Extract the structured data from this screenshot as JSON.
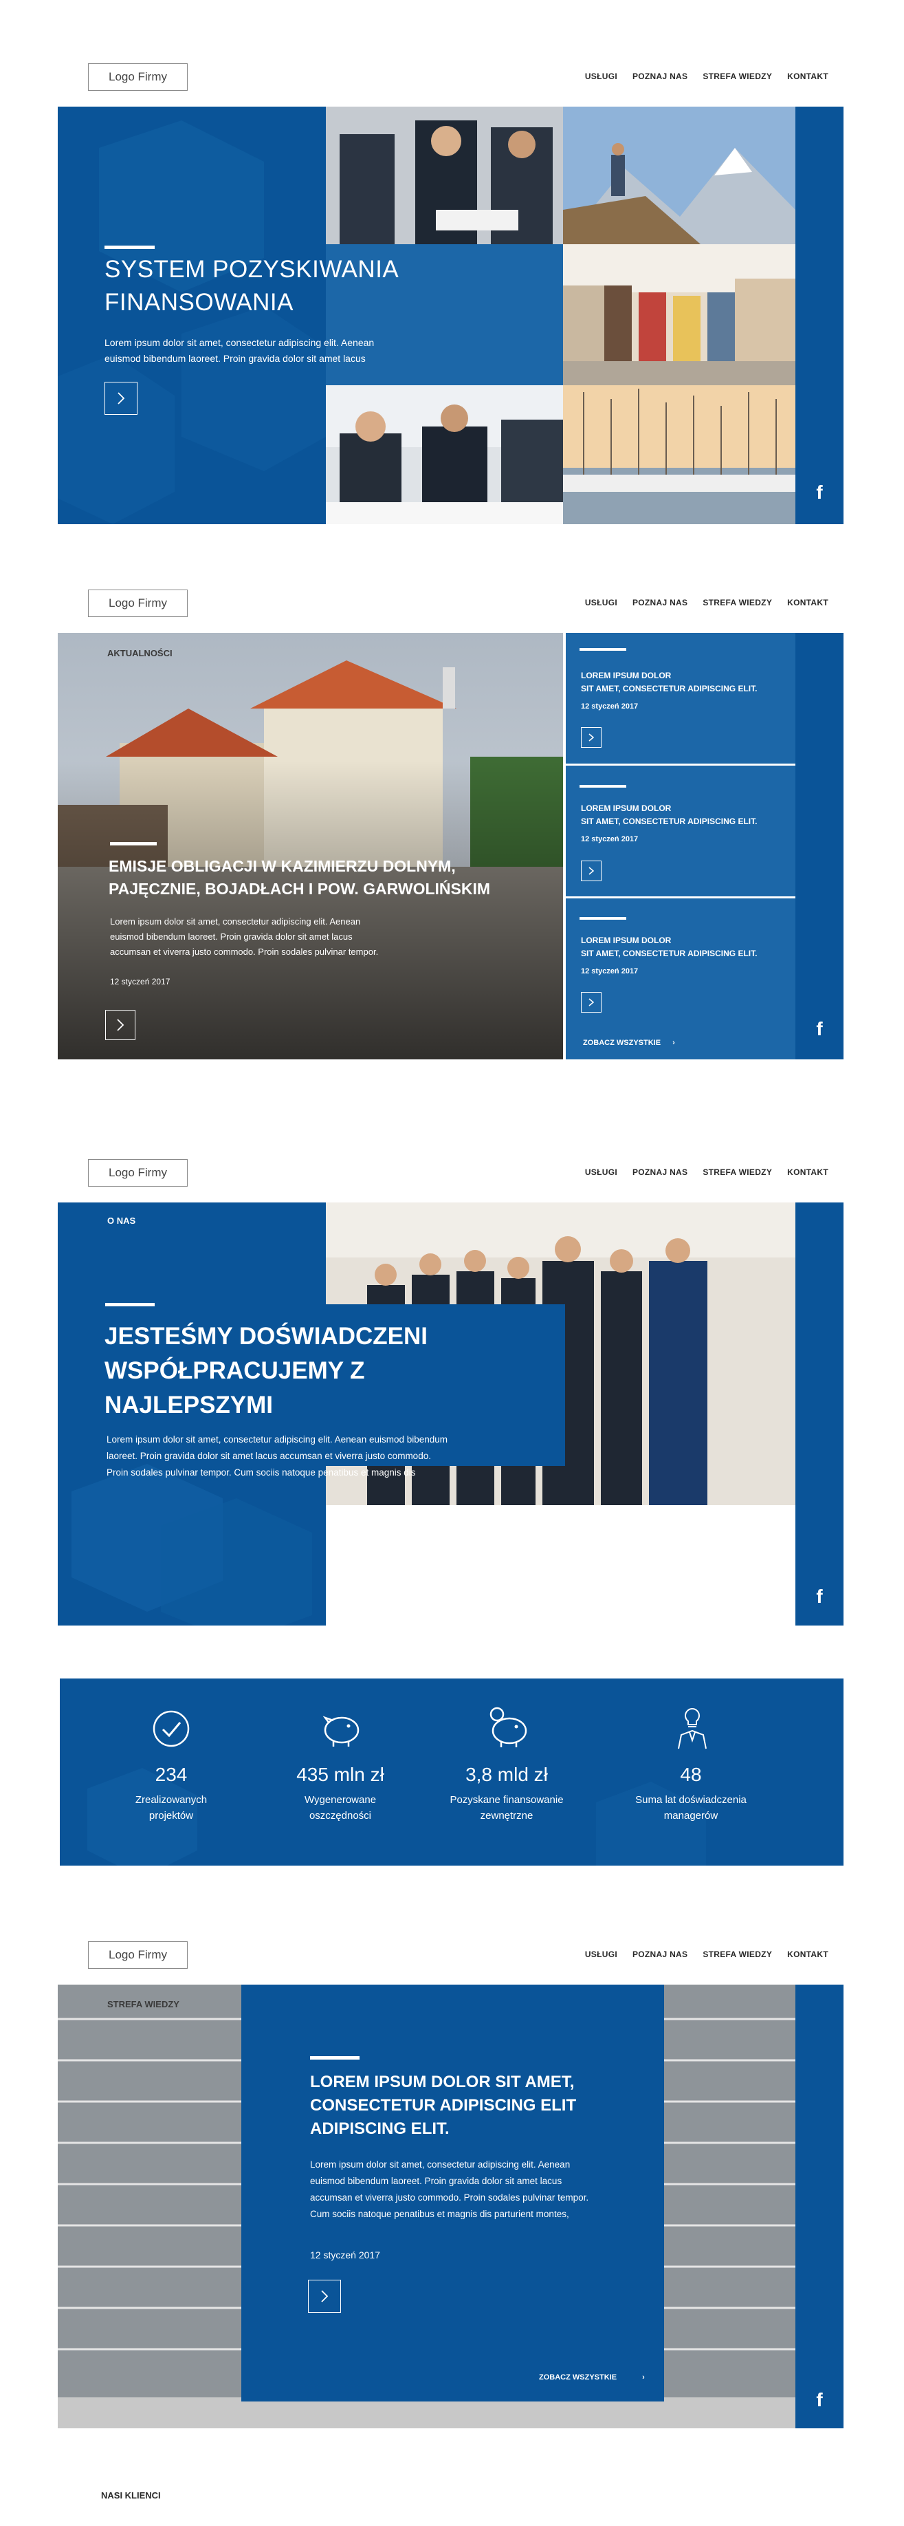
{
  "header": {
    "logo": "Logo Firmy",
    "nav": [
      "USŁUGI",
      "POZNAJ NAS",
      "STREFA WIEDZY",
      "KONTAKT"
    ]
  },
  "facebook_label": "f",
  "hero": {
    "title_line1": "SYSTEM POZYSKIWANIA",
    "title_line2": "FINANSOWANIA",
    "text_line1": "Lorem ipsum dolor sit amet, consectetur adipiscing elit. Aenean",
    "text_line2": "euismod bibendum laoreet. Proin gravida dolor sit amet lacus"
  },
  "news": {
    "section_label": "AKTUALNOŚCI",
    "main": {
      "title_line1": "EMISJE OBLIGACJI W KAZIMIERZU DOLNYM,",
      "title_line2": "PAJĘCZNIE, BOJADŁACH I POW. GARWOLIŃSKIM",
      "text_line1": "Lorem ipsum dolor sit amet, consectetur adipiscing elit. Aenean",
      "text_line2": "euismod bibendum laoreet. Proin gravida dolor sit amet lacus",
      "text_line3": "accumsan et viverra justo commodo. Proin sodales pulvinar tempor.",
      "date": "12 styczeń 2017"
    },
    "items": [
      {
        "title_line1": "LOREM IPSUM DOLOR",
        "title_line2": "SIT AMET, CONSECTETUR ADIPISCING ELIT.",
        "date": "12 styczeń 2017"
      },
      {
        "title_line1": "LOREM IPSUM DOLOR",
        "title_line2": "SIT AMET, CONSECTETUR ADIPISCING ELIT.",
        "date": "12 styczeń 2017"
      },
      {
        "title_line1": "LOREM IPSUM DOLOR",
        "title_line2": "SIT AMET, CONSECTETUR ADIPISCING ELIT.",
        "date": "12 styczeń 2017"
      }
    ],
    "see_all": "ZOBACZ WSZYSTKIE"
  },
  "about": {
    "section_label": "O NAS",
    "title_line1": "JESTEŚMY DOŚWIADCZENI",
    "title_line2": "WSPÓŁPRACUJEMY Z",
    "title_line3": "NAJLEPSZYMI",
    "text_line1": "Lorem ipsum dolor sit amet, consectetur adipiscing elit. Aenean euismod bibendum",
    "text_line2": "laoreet. Proin gravida dolor sit amet lacus accumsan et viverra justo commodo.",
    "text_line3": "Proin sodales pulvinar tempor. Cum sociis natoque penatibus et magnis dis"
  },
  "stats": [
    {
      "icon": "check-circle-icon",
      "value": "234",
      "label_line1": "Zrealizowanych",
      "label_line2": "projektów"
    },
    {
      "icon": "piggy-bank-icon",
      "value": "435 mln zł",
      "label_line1": "Wygenerowane",
      "label_line2": "oszczędności"
    },
    {
      "icon": "piggy-coin-icon",
      "value": "3,8 mld zł",
      "label_line1": "Pozyskane finansowanie",
      "label_line2": "zewnętrzne"
    },
    {
      "icon": "manager-bulb-icon",
      "value": "48",
      "label_line1": "Suma lat doświadczenia",
      "label_line2": "managerów"
    }
  ],
  "knowledge": {
    "section_label": "STREFA WIEDZY",
    "title_line1": "LOREM IPSUM DOLOR SIT AMET,",
    "title_line2": "CONSECTETUR ADIPISCING ELIT",
    "title_line3": "ADIPISCING ELIT.",
    "text_line1": "Lorem ipsum dolor sit amet, consectetur adipiscing elit. Aenean",
    "text_line2": "euismod bibendum laoreet. Proin gravida dolor sit amet lacus",
    "text_line3": "accumsan et viverra justo commodo. Proin sodales pulvinar tempor.",
    "text_line4": "Cum sociis natoque penatibus et magnis dis parturient montes,",
    "date": "12 styczeń 2017",
    "see_all": "ZOBACZ WSZYSTKIE"
  },
  "clients": {
    "section_label": "NASI KLIENCI"
  },
  "colors": {
    "brand_blue": "#0a5498",
    "secondary_blue": "#1c67a8"
  }
}
